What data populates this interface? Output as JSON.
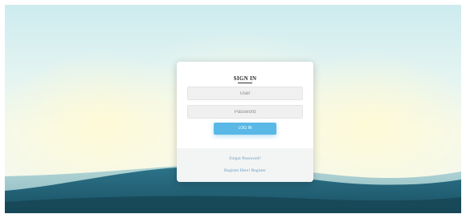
{
  "login_card": {
    "title": "SIGN IN",
    "username": {
      "placeholder": "User",
      "value": ""
    },
    "password": {
      "placeholder": "Password",
      "value": ""
    },
    "login_button_label": "LOG IN",
    "forgot_password_link": "Forgot Password?",
    "register_link": "Register Here! Register"
  },
  "colors": {
    "button": "#5ab8e6",
    "link": "#6a9ec0",
    "wave_dark": "#1f5f73",
    "sky_top": "#cdebef",
    "glow": "#fffad6"
  }
}
